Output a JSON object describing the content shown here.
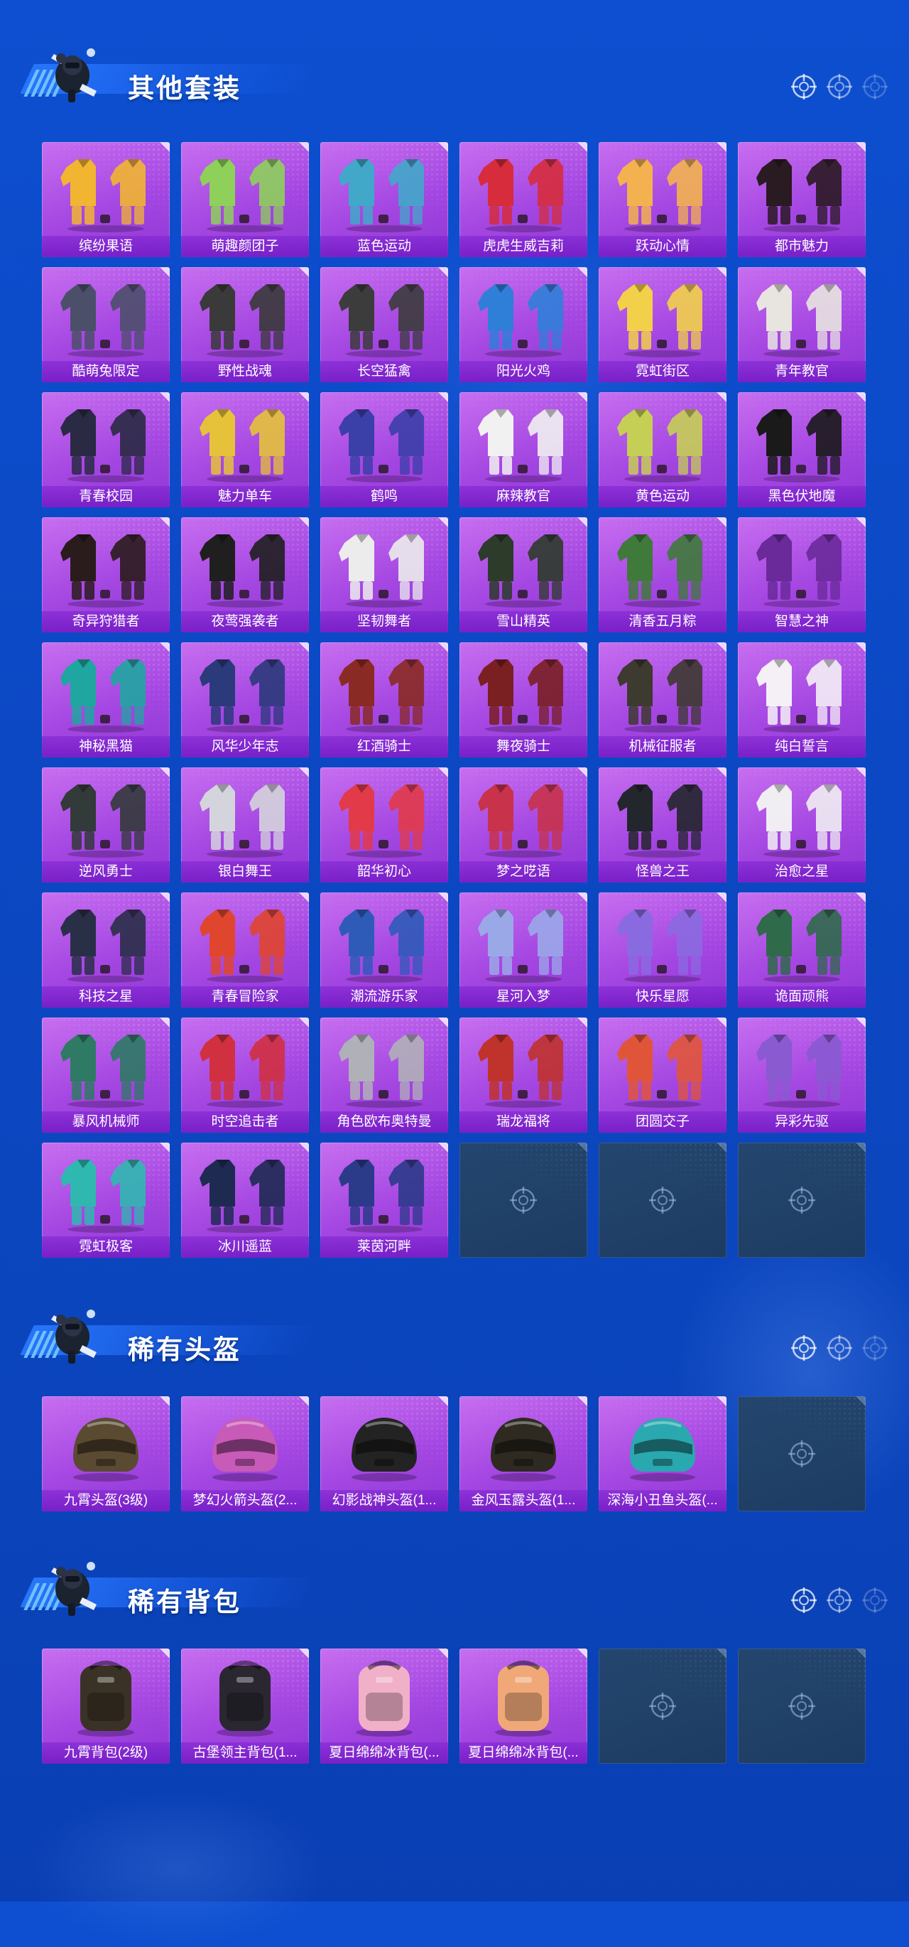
{
  "colors": {
    "page_bg": "#0c48c4",
    "card_purple": "#a547e2",
    "card_label_bg": "#7a1ec8",
    "empty_slot": "#1f3f66",
    "header_band": "#2878ff",
    "title_text": "#ffffff"
  },
  "sections": {
    "outfits": {
      "title": "其他套装",
      "mascot_icon": "parachute-mascot-icon",
      "items": [
        {
          "label": "缤纷果语",
          "icon": "outfit-icon",
          "tint": "#f2b531"
        },
        {
          "label": "萌趣颜团子",
          "icon": "outfit-icon",
          "tint": "#8ed05a"
        },
        {
          "label": "蓝色运动",
          "icon": "outfit-icon",
          "tint": "#41a8c9"
        },
        {
          "label": "虎虎生威吉莉",
          "icon": "outfit-icon",
          "tint": "#d62c3c"
        },
        {
          "label": "跃动心情",
          "icon": "outfit-icon",
          "tint": "#f3b24f"
        },
        {
          "label": "都市魅力",
          "icon": "outfit-icon",
          "tint": "#2a1a22"
        },
        {
          "label": "酷萌兔限定",
          "icon": "outfit-icon",
          "tint": "#4c4f6a"
        },
        {
          "label": "野性战魂",
          "icon": "outfit-icon",
          "tint": "#3a3a3a"
        },
        {
          "label": "长空猛禽",
          "icon": "outfit-icon",
          "tint": "#3c3c3c"
        },
        {
          "label": "阳光火鸡",
          "icon": "outfit-icon",
          "tint": "#2f7fd8"
        },
        {
          "label": "霓虹街区",
          "icon": "outfit-icon",
          "tint": "#f2d04a"
        },
        {
          "label": "青年教官",
          "icon": "outfit-icon",
          "tint": "#e8e4e0"
        },
        {
          "label": "青春校园",
          "icon": "outfit-icon",
          "tint": "#2a2a44"
        },
        {
          "label": "魅力单车",
          "icon": "outfit-icon",
          "tint": "#e6c23a"
        },
        {
          "label": "鹤鸣",
          "icon": "outfit-icon",
          "tint": "#3b3fa8"
        },
        {
          "label": "麻辣教官",
          "icon": "outfit-icon",
          "tint": "#f1f1f1"
        },
        {
          "label": "黄色运动",
          "icon": "outfit-icon",
          "tint": "#c6cf55"
        },
        {
          "label": "黑色伏地魔",
          "icon": "outfit-icon",
          "tint": "#1a1a1a"
        },
        {
          "label": "奇异狩猎者",
          "icon": "outfit-icon",
          "tint": "#2a1c1c"
        },
        {
          "label": "夜莺强袭者",
          "icon": "outfit-icon",
          "tint": "#1f1f1f"
        },
        {
          "label": "坚韧舞者",
          "icon": "outfit-icon",
          "tint": "#ececec"
        },
        {
          "label": "雪山精英",
          "icon": "outfit-icon",
          "tint": "#2c3b2a"
        },
        {
          "label": "清香五月粽",
          "icon": "outfit-icon",
          "tint": "#3f7a3a"
        },
        {
          "label": "智慧之神",
          "icon": "outfit-icon",
          "tint": "#6a2a9a"
        },
        {
          "label": "神秘黑猫",
          "icon": "outfit-icon",
          "tint": "#1fa6a0"
        },
        {
          "label": "风华少年志",
          "icon": "outfit-icon",
          "tint": "#2a3a7a"
        },
        {
          "label": "红酒骑士",
          "icon": "outfit-icon",
          "tint": "#8a2a24"
        },
        {
          "label": "舞夜骑士",
          "icon": "outfit-icon",
          "tint": "#7a1f22"
        },
        {
          "label": "机械征服者",
          "icon": "outfit-icon",
          "tint": "#3d3a30"
        },
        {
          "label": "纯白誓言",
          "icon": "outfit-icon",
          "tint": "#f4f0f6"
        },
        {
          "label": "逆风勇士",
          "icon": "outfit-icon",
          "tint": "#333a3a"
        },
        {
          "label": "银白舞王",
          "icon": "outfit-icon",
          "tint": "#d4d4dc"
        },
        {
          "label": "韶华初心",
          "icon": "outfit-icon",
          "tint": "#e23a48"
        },
        {
          "label": "梦之呓语",
          "icon": "outfit-icon",
          "tint": "#c8324a"
        },
        {
          "label": "怪兽之王",
          "icon": "outfit-icon",
          "tint": "#23262c"
        },
        {
          "label": "治愈之星",
          "icon": "outfit-icon",
          "tint": "#f0eef2"
        },
        {
          "label": "科技之星",
          "icon": "outfit-icon",
          "tint": "#2a2f48"
        },
        {
          "label": "青春冒险家",
          "icon": "outfit-icon",
          "tint": "#e0452e"
        },
        {
          "label": "潮流游乐家",
          "icon": "outfit-icon",
          "tint": "#2f5bb8"
        },
        {
          "label": "星河入梦",
          "icon": "outfit-icon",
          "tint": "#9aa8e8"
        },
        {
          "label": "快乐星愿",
          "icon": "outfit-icon",
          "tint": "#8a6ae0"
        },
        {
          "label": "诡面顽熊",
          "icon": "outfit-icon",
          "tint": "#2f6a4a"
        },
        {
          "label": "暴风机械师",
          "icon": "outfit-icon",
          "tint": "#2e7a64"
        },
        {
          "label": "时空追击者",
          "icon": "outfit-icon",
          "tint": "#d03040"
        },
        {
          "label": "角色欧布奥特曼",
          "icon": "outfit-icon",
          "tint": "#b0b0b8"
        },
        {
          "label": "瑞龙福将",
          "icon": "outfit-icon",
          "tint": "#c0322c"
        },
        {
          "label": "团圆交子",
          "icon": "outfit-icon",
          "tint": "#e0553a"
        },
        {
          "label": "异彩先驱",
          "icon": "outfit-icon",
          "tint": "#8a5ad0"
        },
        {
          "label": "霓虹极客",
          "icon": "outfit-icon",
          "tint": "#2fb8b0"
        },
        {
          "label": "冰川遥蓝",
          "icon": "outfit-icon",
          "tint": "#1e2a52"
        },
        {
          "label": "莱茵河畔",
          "icon": "outfit-icon",
          "tint": "#2c3a8a"
        }
      ],
      "empty_slots": 3
    },
    "helmets": {
      "title": "稀有头盔",
      "mascot_icon": "parachute-mascot-icon",
      "items": [
        {
          "label": "九霄头盔(3级)",
          "icon": "helmet-icon",
          "tint": "#5a4a32"
        },
        {
          "label": "梦幻火箭头盔(2...",
          "icon": "helmet-icon",
          "tint": "#c85ab8"
        },
        {
          "label": "幻影战神头盔(1...",
          "icon": "helmet-icon",
          "tint": "#232323"
        },
        {
          "label": "金风玉露头盔(1...",
          "icon": "helmet-icon",
          "tint": "#2e2a22"
        },
        {
          "label": "深海小丑鱼头盔(...",
          "icon": "helmet-icon",
          "tint": "#2aa8b0"
        }
      ],
      "empty_slots": 1
    },
    "backpacks": {
      "title": "稀有背包",
      "mascot_icon": "parachute-mascot-icon",
      "items": [
        {
          "label": "九霄背包(2级)",
          "icon": "backpack-icon",
          "tint": "#3a3226"
        },
        {
          "label": "古堡领主背包(1...",
          "icon": "backpack-icon",
          "tint": "#2a2730"
        },
        {
          "label": "夏日绵绵冰背包(...",
          "icon": "backpack-icon",
          "tint": "#f0b0c8"
        },
        {
          "label": "夏日绵绵冰背包(...",
          "icon": "backpack-icon",
          "tint": "#f0a878"
        }
      ],
      "empty_slots": 2
    }
  }
}
